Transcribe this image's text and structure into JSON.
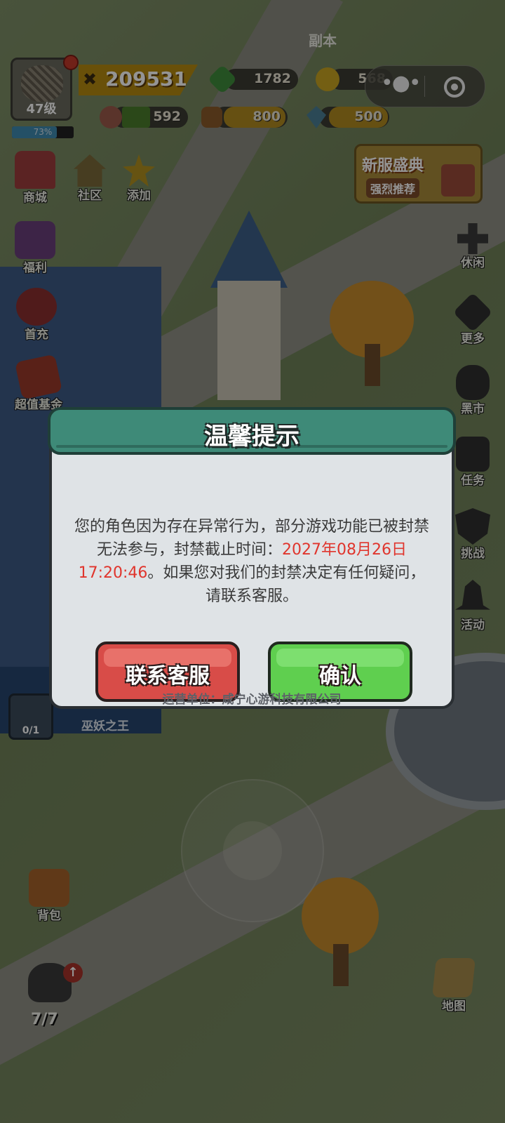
{
  "top": {
    "dungeon_label": "副本"
  },
  "player": {
    "level": "47级",
    "exp_text": "73%",
    "exp_fraction": 0.73,
    "power": "209531"
  },
  "resources": {
    "gem": "1782",
    "coin": "568",
    "meat": "592",
    "wood": "800",
    "crystal": "500"
  },
  "promo": {
    "title": "新服盛典",
    "subtitle": "强烈推荐"
  },
  "left_menu": {
    "shop": "商城",
    "community": "社区",
    "add": "添加",
    "welfare": "福利",
    "first_recharge": "首充",
    "value_fund": "超值基金"
  },
  "right_menu": {
    "leisure": "休闲",
    "more": "更多",
    "black_market": "黑市",
    "task": "任务",
    "challenge": "挑战",
    "activity": "活动",
    "map": "地图"
  },
  "boss": {
    "progress": "0/1",
    "name": "巫妖之王"
  },
  "bottom": {
    "bag": "背包",
    "troops": "7/7"
  },
  "dialog": {
    "title": "温馨提示",
    "message_part1": "您的角色因为存在异常行为，部分游戏功能已被封禁无法参与，封禁截止时间：",
    "ban_until": "2027年08月26日 17:20:46",
    "message_part2": "。如果您对我们的封禁决定有任何疑问，请联系客服。",
    "contact_button": "联系客服",
    "confirm_button": "确认",
    "operator": "运营单位：咸宁心游科技有限公司"
  },
  "colors": {
    "dialog_header": "#3e8a78",
    "contact_button": "#d84c48",
    "confirm_button": "#5fcf4f",
    "ban_time": "#e0352d"
  }
}
